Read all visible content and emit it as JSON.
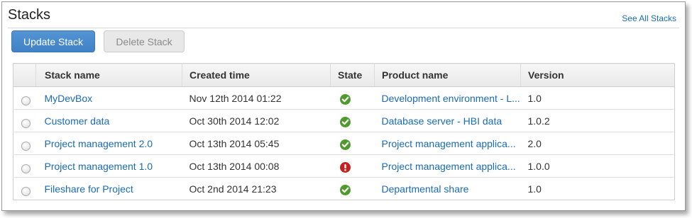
{
  "page": {
    "title": "Stacks",
    "see_all_link": "See All Stacks"
  },
  "toolbar": {
    "update_label": "Update Stack",
    "delete_label": "Delete Stack"
  },
  "table": {
    "headers": {
      "stack_name": "Stack name",
      "created_time": "Created time",
      "state": "State",
      "product_name": "Product name",
      "version": "Version"
    },
    "rows": [
      {
        "stack_name": "MyDevBox",
        "created_time": "Nov 12th 2014 01:22",
        "state": "ok",
        "product_name": "Development environment - L...",
        "version": "1.0"
      },
      {
        "stack_name": "Customer data",
        "created_time": "Oct 30th 2014 12:02",
        "state": "ok",
        "product_name": "Database server - HBI data",
        "version": "1.0.2"
      },
      {
        "stack_name": "Project management 2.0",
        "created_time": "Oct 13th 2014 05:45",
        "state": "ok",
        "product_name": "Project management applica...",
        "version": "2.0"
      },
      {
        "stack_name": "Project management 1.0",
        "created_time": "Oct 13th 2014 00:08",
        "state": "error",
        "product_name": "Project management applica...",
        "version": "1.0.0"
      },
      {
        "stack_name": "Fileshare for Project",
        "created_time": "Oct 2nd 2014 21:23",
        "state": "ok",
        "product_name": "Departmental share",
        "version": "1.0"
      }
    ]
  },
  "icons": {
    "state_ok": "check-circle-icon",
    "state_error": "exclamation-circle-icon"
  },
  "colors": {
    "primary_button": "#4a8bcd",
    "link": "#1a6bb5",
    "state_ok": "#4f9a2a",
    "state_error": "#c8201c"
  }
}
